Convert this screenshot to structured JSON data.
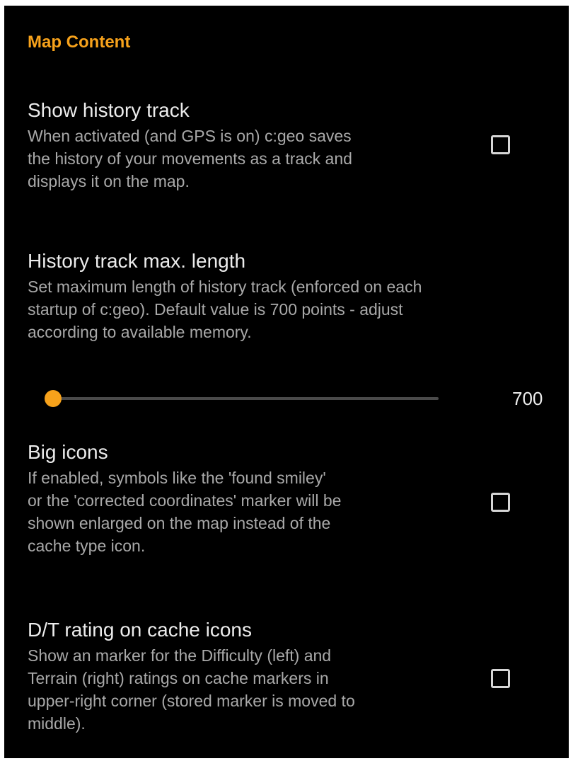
{
  "section": {
    "title": "Map Content"
  },
  "prefs": {
    "history_track": {
      "title": "Show history track",
      "summary": "When activated (and GPS is on) c:geo saves\nthe history of your movements as a track and\ndisplays it on the map.",
      "checked": false
    },
    "history_length": {
      "title": "History track max. length",
      "summary": "Set maximum length of history track (enforced on each\nstartup of c:geo). Default value is 700 points - adjust\naccording to available memory.",
      "value_label": "700",
      "slider_fraction": 0.02
    },
    "big_icons": {
      "title": "Big icons",
      "summary": "If enabled, symbols like the 'found smiley'\nor the 'corrected coordinates' marker will be\nshown enlarged on the map instead of the\ncache type icon.",
      "checked": false
    },
    "dt_rating": {
      "title": "D/T rating on cache icons",
      "summary": "Show an marker for the Difficulty (left) and\nTerrain (right) ratings on cache markers in\nupper-right corner (stored marker is moved to\nmiddle).",
      "checked": false
    }
  },
  "colors": {
    "accent": "#f7a21b",
    "background": "#000000",
    "title_text": "#ececec",
    "summary_text": "#a9a9a9"
  }
}
